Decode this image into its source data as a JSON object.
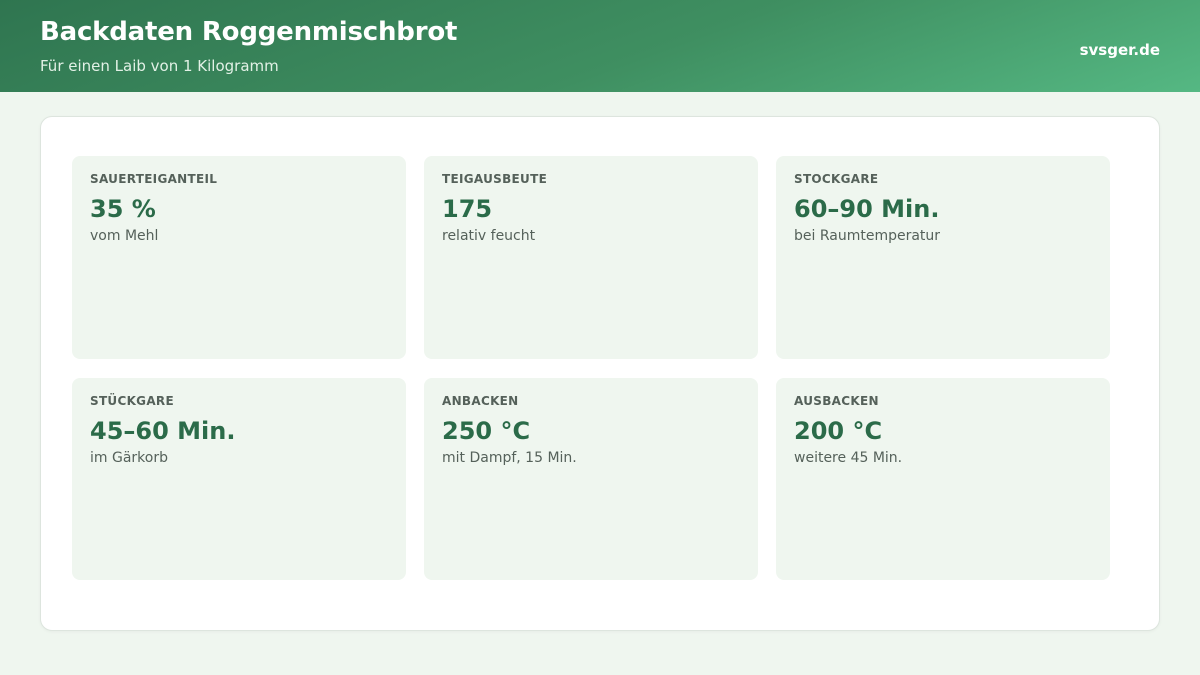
{
  "header": {
    "title": "Backdaten Roggenmischbrot",
    "subtitle": "Für einen Laib von 1 Kilogramm",
    "brand": "svsger.de"
  },
  "cards": [
    {
      "label": "SAUERTEIGANTEIL",
      "value": "35 %",
      "note": "vom Mehl"
    },
    {
      "label": "TEIGAUSBEUTE",
      "value": "175",
      "note": "relativ feucht"
    },
    {
      "label": "STOCKGARE",
      "value": "60–90 Min.",
      "note": "bei Raumtemperatur"
    },
    {
      "label": "STÜCKGARE",
      "value": "45–60 Min.",
      "note": "im Gärkorb"
    },
    {
      "label": "ANBACKEN",
      "value": "250 °C",
      "note": "mit Dampf, 15 Min."
    },
    {
      "label": "AUSBACKEN",
      "value": "200 °C",
      "note": "weitere 45 Min."
    }
  ],
  "colors": {
    "accent": "#2b6b49",
    "header_start": "#2f7550",
    "header_end": "#55b883",
    "background": "#eff6ef"
  }
}
